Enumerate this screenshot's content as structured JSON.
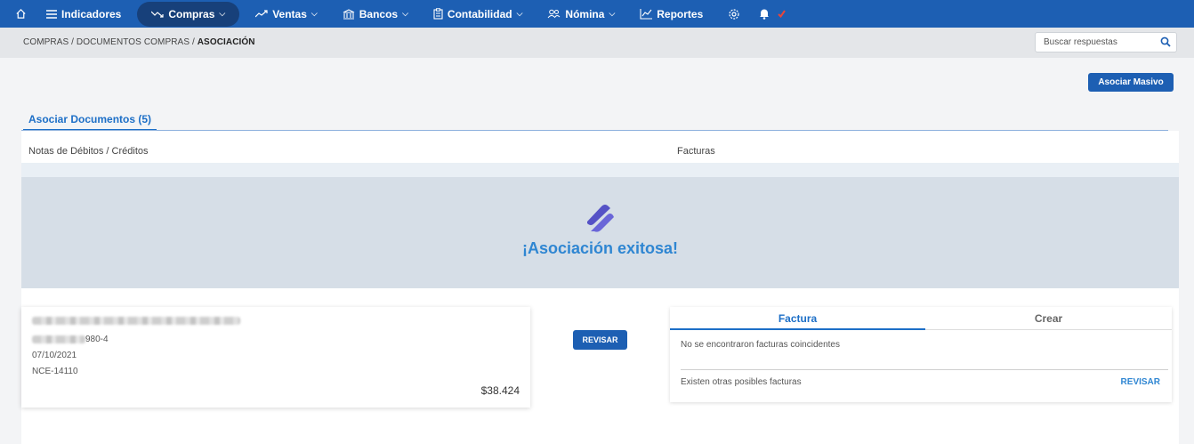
{
  "nav": {
    "items": [
      {
        "label": "Indicadores",
        "icon": "list-icon"
      },
      {
        "label": "Compras",
        "icon": "trend-down-icon",
        "active": true
      },
      {
        "label": "Ventas",
        "icon": "trend-up-icon"
      },
      {
        "label": "Bancos",
        "icon": "bank-icon"
      },
      {
        "label": "Contabilidad",
        "icon": "clipboard-icon"
      },
      {
        "label": "Nómina",
        "icon": "people-icon"
      },
      {
        "label": "Reportes",
        "icon": "chart-line-icon"
      }
    ],
    "colors": {
      "bar": "#1d5fb3",
      "active": "#17407a"
    }
  },
  "breadcrumb": {
    "part1": "COMPRAS",
    "part2": "DOCUMENTOS COMPRAS",
    "current": "ASOCIACIÓN",
    "sep": " / "
  },
  "search": {
    "placeholder": "Buscar respuestas"
  },
  "toolbar": {
    "masivo_label": "Asociar Masivo"
  },
  "tab": {
    "label": "Asociar Documentos (5)"
  },
  "columns": {
    "left": "Notas de Débitos / Créditos",
    "right": "Facturas"
  },
  "success": {
    "message": "¡Asociación exitosa!",
    "accent": "#2f86d2"
  },
  "doc": {
    "id_suffix": "980-4",
    "date": "07/10/2021",
    "number": "NCE-14110",
    "amount": "$38.424"
  },
  "revisar_button": "REVISAR",
  "factura": {
    "tab_factura": "Factura",
    "tab_crear": "Crear",
    "no_match": "No se encontraron facturas coincidentes",
    "otras": "Existen otras posibles facturas",
    "link": "REVISAR"
  }
}
